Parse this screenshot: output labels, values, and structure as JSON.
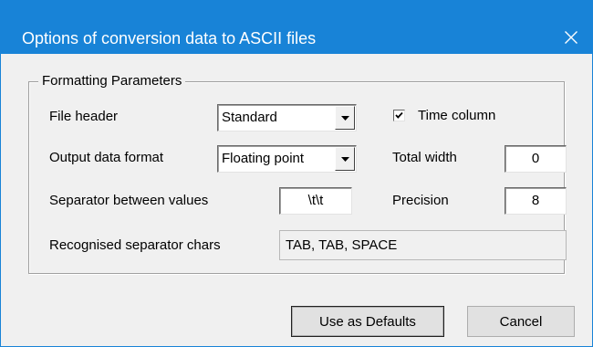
{
  "window": {
    "title": "Options of conversion data to ASCII files",
    "close_glyph": "✕"
  },
  "group": {
    "legend": "Formatting Parameters"
  },
  "file_header": {
    "label": "File header",
    "value": "Standard"
  },
  "time_column": {
    "label": "Time column",
    "checked": true
  },
  "output_format": {
    "label": "Output data format",
    "value": "Floating point"
  },
  "total_width": {
    "label": "Total width",
    "value": "0"
  },
  "separator": {
    "label": "Separator between values",
    "value": "\\t\\t"
  },
  "precision": {
    "label": "Precision",
    "value": "8"
  },
  "recognised": {
    "label": "Recognised separator chars",
    "value": "TAB, TAB, SPACE"
  },
  "buttons": {
    "defaults_label": "Use as Defaults",
    "cancel_label": "Cancel"
  },
  "colors": {
    "titlebar": "#1883d7",
    "dialog_bg": "#f0f0f0"
  }
}
